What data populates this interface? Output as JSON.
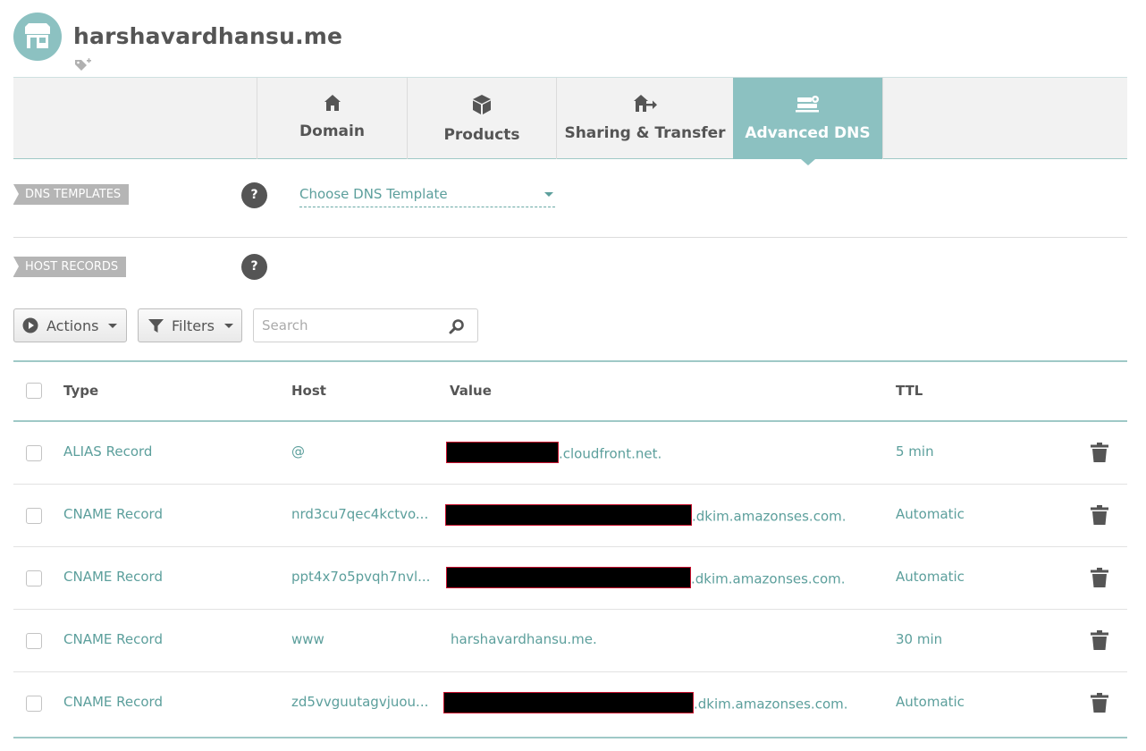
{
  "header": {
    "domain": "harshavardhansu.me"
  },
  "tabs": [
    {
      "label": "Domain",
      "icon": "house-icon",
      "active": false
    },
    {
      "label": "Products",
      "icon": "box-icon",
      "active": false
    },
    {
      "label": "Sharing & Transfer",
      "icon": "house-transfer-icon",
      "active": false
    },
    {
      "label": "Advanced DNS",
      "icon": "dns-server-icon",
      "active": true
    }
  ],
  "dns_templates": {
    "label": "DNS TEMPLATES",
    "help": "?",
    "select_value": "Choose DNS Template"
  },
  "host_records": {
    "label": "HOST RECORDS",
    "help": "?"
  },
  "toolbar": {
    "actions_label": "Actions",
    "filters_label": "Filters",
    "search_placeholder": "Search"
  },
  "table": {
    "columns": {
      "type": "Type",
      "host": "Host",
      "value": "Value",
      "ttl": "TTL"
    },
    "rows": [
      {
        "type": "ALIAS Record",
        "host": "@",
        "value_suffix": ".cloudfront.net.",
        "ttl": "5 min",
        "redacted": true
      },
      {
        "type": "CNAME Record",
        "host": "nrd3cu7qec4kctvo...",
        "value_suffix": ".dkim.amazonses.com.",
        "ttl": "Automatic",
        "redacted": true
      },
      {
        "type": "CNAME Record",
        "host": "ppt4x7o5pvqh7nvl...",
        "value_suffix": ".dkim.amazonses.com.",
        "ttl": "Automatic",
        "redacted": true
      },
      {
        "type": "CNAME Record",
        "host": "www",
        "value_suffix": "harshavardhansu.me.",
        "ttl": "30 min",
        "redacted": false
      },
      {
        "type": "CNAME Record",
        "host": "zd5vvguutagvjuou...",
        "value_suffix": ".dkim.amazonses.com.",
        "ttl": "Automatic",
        "redacted": true
      }
    ]
  },
  "colors": {
    "accent": "#8cc1c1",
    "link": "#5c9f9c",
    "label_bg": "#b5b5b5",
    "text": "#555555"
  }
}
